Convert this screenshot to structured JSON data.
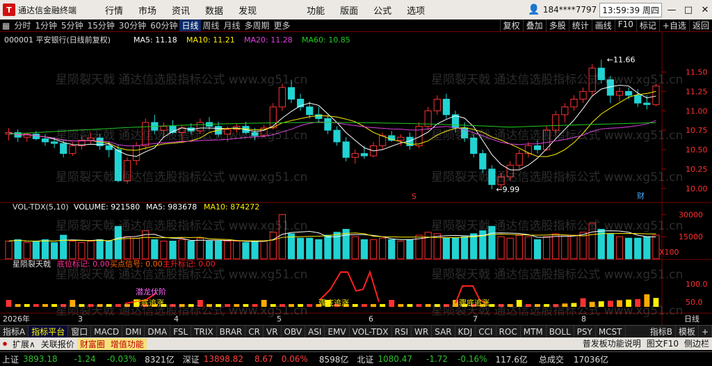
{
  "app": {
    "title": "通达信金融终端"
  },
  "menu": {
    "items": [
      "行情",
      "市场",
      "资讯",
      "数据",
      "发现",
      "功能",
      "版面",
      "公式",
      "选项"
    ],
    "user": "184****7797",
    "time": "13:59:39 周四",
    "window_buttons": [
      "—",
      "□",
      "✕"
    ]
  },
  "toolbar": {
    "periods": [
      "分时",
      "1分钟",
      "5分钟",
      "15分钟",
      "30分钟",
      "60分钟",
      "日线",
      "周线",
      "月线",
      "多周期",
      "更多"
    ],
    "active_period": "日线",
    "right_items": [
      "复权",
      "叠加",
      "多股",
      "统计",
      "画线",
      "F10",
      "标记",
      "+自选",
      "返回"
    ]
  },
  "chart_data": [
    {
      "type": "candlestick",
      "title": "000001 平安银行(日线前复权)",
      "legend": {
        "MA5": "11.18",
        "MA10": "11.21",
        "MA20": "11.28",
        "MA60": "10.85"
      },
      "yticks": [
        "11.50",
        "11.25",
        "11.00",
        "10.75",
        "10.50",
        "10.25",
        "10.00"
      ],
      "ylim": [
        9.9,
        11.8
      ],
      "annotations": {
        "high": "11.66",
        "low": "9.99",
        "marker_s": "S",
        "marker_cai": "财"
      },
      "ohlc": [
        [
          10.7,
          10.78,
          10.62,
          10.72
        ],
        [
          10.72,
          10.76,
          10.6,
          10.66
        ],
        [
          10.66,
          10.72,
          10.6,
          10.7
        ],
        [
          10.7,
          10.74,
          10.62,
          10.64
        ],
        [
          10.64,
          10.7,
          10.55,
          10.6
        ],
        [
          10.6,
          10.66,
          10.52,
          10.58
        ],
        [
          10.58,
          10.62,
          10.4,
          10.45
        ],
        [
          10.45,
          10.6,
          10.42,
          10.55
        ],
        [
          10.55,
          10.68,
          10.5,
          10.62
        ],
        [
          10.62,
          10.72,
          10.58,
          10.65
        ],
        [
          10.65,
          10.7,
          10.5,
          10.55
        ],
        [
          10.55,
          10.6,
          10.4,
          10.5
        ],
        [
          10.5,
          10.56,
          10.08,
          10.1
        ],
        [
          10.1,
          10.4,
          10.06,
          10.36
        ],
        [
          10.36,
          10.6,
          10.3,
          10.55
        ],
        [
          10.55,
          10.9,
          10.5,
          10.85
        ],
        [
          10.85,
          10.95,
          10.7,
          10.75
        ],
        [
          10.75,
          10.85,
          10.65,
          10.8
        ],
        [
          10.8,
          10.88,
          10.7,
          10.72
        ],
        [
          10.72,
          10.82,
          10.6,
          10.78
        ],
        [
          10.78,
          10.84,
          10.7,
          10.74
        ],
        [
          10.74,
          10.9,
          10.7,
          10.85
        ],
        [
          10.85,
          10.92,
          10.76,
          10.8
        ],
        [
          10.8,
          10.86,
          10.66,
          10.7
        ],
        [
          10.7,
          10.8,
          10.6,
          10.76
        ],
        [
          10.76,
          10.84,
          10.72,
          10.8
        ],
        [
          10.8,
          10.86,
          10.7,
          10.72
        ],
        [
          10.72,
          10.78,
          10.62,
          10.68
        ],
        [
          10.68,
          10.82,
          10.66,
          10.78
        ],
        [
          10.78,
          11.1,
          10.76,
          11.05
        ],
        [
          11.05,
          11.35,
          11.0,
          11.3
        ],
        [
          11.3,
          11.4,
          11.1,
          11.15
        ],
        [
          11.15,
          11.22,
          11.0,
          11.05
        ],
        [
          11.05,
          11.12,
          10.9,
          10.95
        ],
        [
          10.95,
          11.05,
          10.85,
          10.9
        ],
        [
          10.9,
          10.95,
          10.7,
          10.75
        ],
        [
          10.75,
          10.8,
          10.55,
          10.6
        ],
        [
          10.6,
          10.66,
          10.35,
          10.4
        ],
        [
          10.4,
          10.5,
          10.32,
          10.45
        ],
        [
          10.45,
          10.55,
          10.38,
          10.42
        ],
        [
          10.42,
          10.6,
          10.4,
          10.55
        ],
        [
          10.55,
          10.72,
          10.5,
          10.68
        ],
        [
          10.68,
          10.74,
          10.6,
          10.62
        ],
        [
          10.62,
          10.7,
          10.55,
          10.66
        ],
        [
          10.66,
          10.72,
          10.5,
          10.55
        ],
        [
          10.55,
          10.85,
          10.52,
          10.8
        ],
        [
          10.8,
          11.05,
          10.75,
          11.0
        ],
        [
          11.0,
          11.2,
          10.95,
          11.15
        ],
        [
          11.15,
          11.22,
          10.9,
          10.95
        ],
        [
          10.95,
          11.0,
          10.72,
          10.78
        ],
        [
          10.78,
          10.85,
          10.6,
          10.65
        ],
        [
          10.65,
          10.7,
          10.4,
          10.45
        ],
        [
          10.45,
          10.5,
          10.2,
          10.25
        ],
        [
          10.25,
          10.3,
          9.99,
          10.05
        ],
        [
          10.05,
          10.2,
          10.0,
          10.15
        ],
        [
          10.15,
          10.35,
          10.1,
          10.3
        ],
        [
          10.3,
          10.5,
          10.25,
          10.45
        ],
        [
          10.45,
          10.6,
          10.4,
          10.55
        ],
        [
          10.55,
          10.62,
          10.45,
          10.5
        ],
        [
          10.5,
          10.8,
          10.48,
          10.75
        ],
        [
          10.75,
          11.0,
          10.7,
          10.95
        ],
        [
          10.95,
          11.1,
          10.85,
          11.05
        ],
        [
          11.05,
          11.2,
          11.0,
          11.15
        ],
        [
          11.15,
          11.3,
          11.1,
          11.25
        ],
        [
          11.25,
          11.6,
          11.2,
          11.55
        ],
        [
          11.55,
          11.66,
          11.35,
          11.4
        ],
        [
          11.4,
          11.45,
          11.1,
          11.2
        ],
        [
          11.2,
          11.3,
          11.12,
          11.25
        ],
        [
          11.25,
          11.3,
          11.15,
          11.2
        ],
        [
          11.2,
          11.28,
          11.05,
          11.1
        ],
        [
          11.1,
          11.2,
          11.02,
          11.08
        ],
        [
          11.08,
          11.35,
          11.06,
          11.32
        ]
      ]
    },
    {
      "type": "bar",
      "title": "VOL-TDX(5,10)",
      "legend": {
        "VOLUME": "921580",
        "MA5": "983678",
        "MA10": "874272"
      },
      "yticks": [
        "30000",
        "15000"
      ],
      "unit": "X100",
      "values": [
        12,
        13,
        11,
        12,
        13,
        11,
        16,
        12,
        11,
        12,
        13,
        12,
        22,
        15,
        14,
        19,
        13,
        12,
        12,
        13,
        12,
        14,
        12,
        12,
        12,
        12,
        11,
        12,
        12,
        18,
        30,
        17,
        14,
        14,
        13,
        16,
        18,
        20,
        15,
        13,
        13,
        14,
        13,
        12,
        13,
        16,
        18,
        17,
        14,
        14,
        15,
        17,
        19,
        22,
        15,
        14,
        16,
        15,
        13,
        15,
        17,
        16,
        16,
        18,
        24,
        20,
        17,
        15,
        14,
        14,
        15,
        16
      ]
    },
    {
      "type": "bar",
      "title": "星陨裂天戟",
      "legend": {
        "底位标记": "0.00",
        "买点信号": "0.00",
        "主升标记": "0.00"
      },
      "yticks": [
        "100.0",
        "50.0"
      ],
      "markers": [
        "潜龙伏阶",
        "骤底追涨",
        "骤底追涨",
        "骤底追涨"
      ]
    }
  ],
  "xaxis": {
    "labels": [
      "2026年",
      "3",
      "4",
      "5",
      "6",
      "7",
      "8"
    ],
    "period_label": "日线"
  },
  "tabs": {
    "items": [
      "指标A",
      "指标平台",
      "窗口",
      "MACD",
      "DMI",
      "DMA",
      "FSL",
      "TRIX",
      "BRAR",
      "CR",
      "VR",
      "OBV",
      "ASI",
      "EMV",
      "VOL-TDX",
      "RSI",
      "WR",
      "SAR",
      "KDJ",
      "CCI",
      "ROC",
      "MTM",
      "BOLL",
      "PSY",
      "MCST"
    ],
    "right": [
      "指标B",
      "模板",
      "+"
    ]
  },
  "ext": {
    "items": [
      "扩展∧",
      "关联报价",
      "财富圈",
      "增值功能"
    ],
    "right": [
      "普发板功能说明",
      "图文F10",
      "侧边栏"
    ]
  },
  "status": {
    "sh_label": "上证",
    "sh_val": "3893.18",
    "sh_chg": "-1.24",
    "sh_pct": "-0.03%",
    "sh_amt": "8321亿",
    "sz_label": "深证",
    "sz_val": "13898.82",
    "sz_chg": "8.67",
    "sz_pct": "0.06%",
    "sz_amt": "8598亿",
    "bz_label": "北证",
    "bz_val": "1080.47",
    "bz_chg": "-1.72",
    "bz_pct": "-0.16%",
    "bz_amt": "117.6亿",
    "total_label": "总成交",
    "total_val": "17036亿"
  },
  "watermark": "星陨裂天戟 通达信选股指标公式 www.xg51.cn",
  "colors": {
    "up": "#ff3030",
    "down": "#22d3d3",
    "ma5": "#ffffff",
    "ma10": "#ffee00",
    "ma20": "#e040e0",
    "ma60": "#22cc22"
  }
}
